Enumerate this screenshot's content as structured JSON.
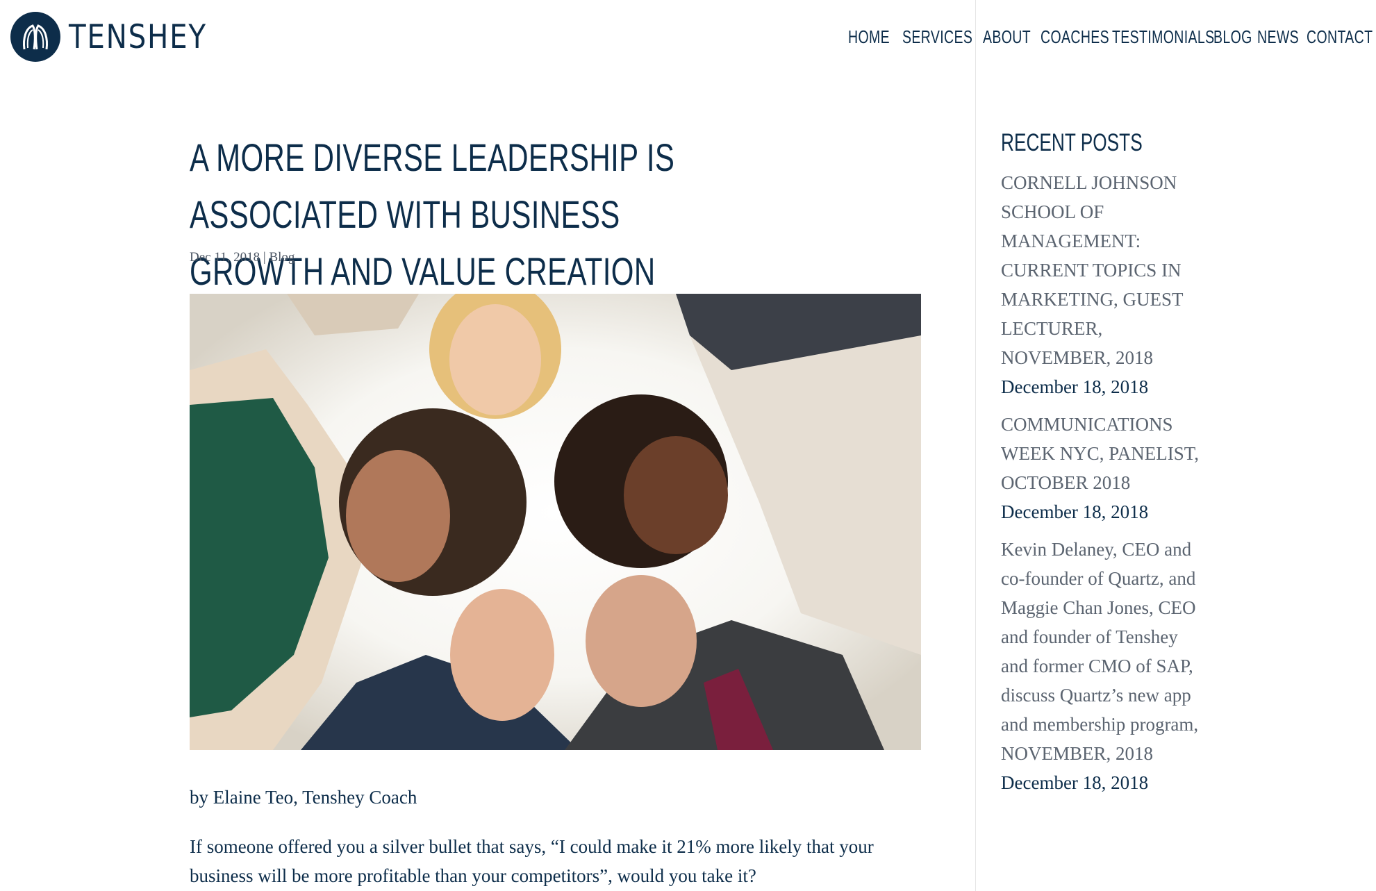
{
  "brand": {
    "name": "TENSHEY",
    "logo_icon": "tenshey-logo-icon"
  },
  "nav": {
    "items": [
      {
        "label": "HOME"
      },
      {
        "label": "SERVICES"
      },
      {
        "label": "ABOUT"
      },
      {
        "label": "COACHES"
      },
      {
        "label": "TESTIMONIALS"
      },
      {
        "label": "BLOG"
      },
      {
        "label": "NEWS"
      },
      {
        "label": "CONTACT"
      }
    ]
  },
  "article": {
    "title": "A MORE DIVERSE LEADERSHIP IS ASSOCIATED WITH BUSINESS GROWTH AND VALUE CREATION",
    "date": "Dec 11, 2018",
    "separator": "|",
    "category": "Blog",
    "byline": "by Elaine Teo, Tenshey Coach",
    "paragraph": "If someone offered you a silver bullet that says, “I could make it 21% more likely that your business will be more profitable than your competitors”, would you take it?"
  },
  "sidebar": {
    "heading": "RECENT POSTS",
    "posts": [
      {
        "title": "CORNELL JOHNSON SCHOOL OF MANAGEMENT: CURRENT TOPICS IN MARKETING, GUEST LECTURER, NOVEMBER, 2018",
        "date": "December 18, 2018"
      },
      {
        "title": "COMMUNICATIONS WEEK NYC, PANELIST, OCTOBER 2018",
        "date": "December 18, 2018"
      },
      {
        "title": "Kevin Delaney, CEO and co-founder of Quartz, and Maggie Chan Jones, CEO and founder of Tenshey and former CMO of SAP, discuss Quartz’s new app and membership program, NOVEMBER, 2018",
        "date": "December 18, 2018"
      }
    ]
  },
  "colors": {
    "navy": "#0d2d4a",
    "muted": "#5b6470",
    "divider": "#e6e6e6"
  }
}
